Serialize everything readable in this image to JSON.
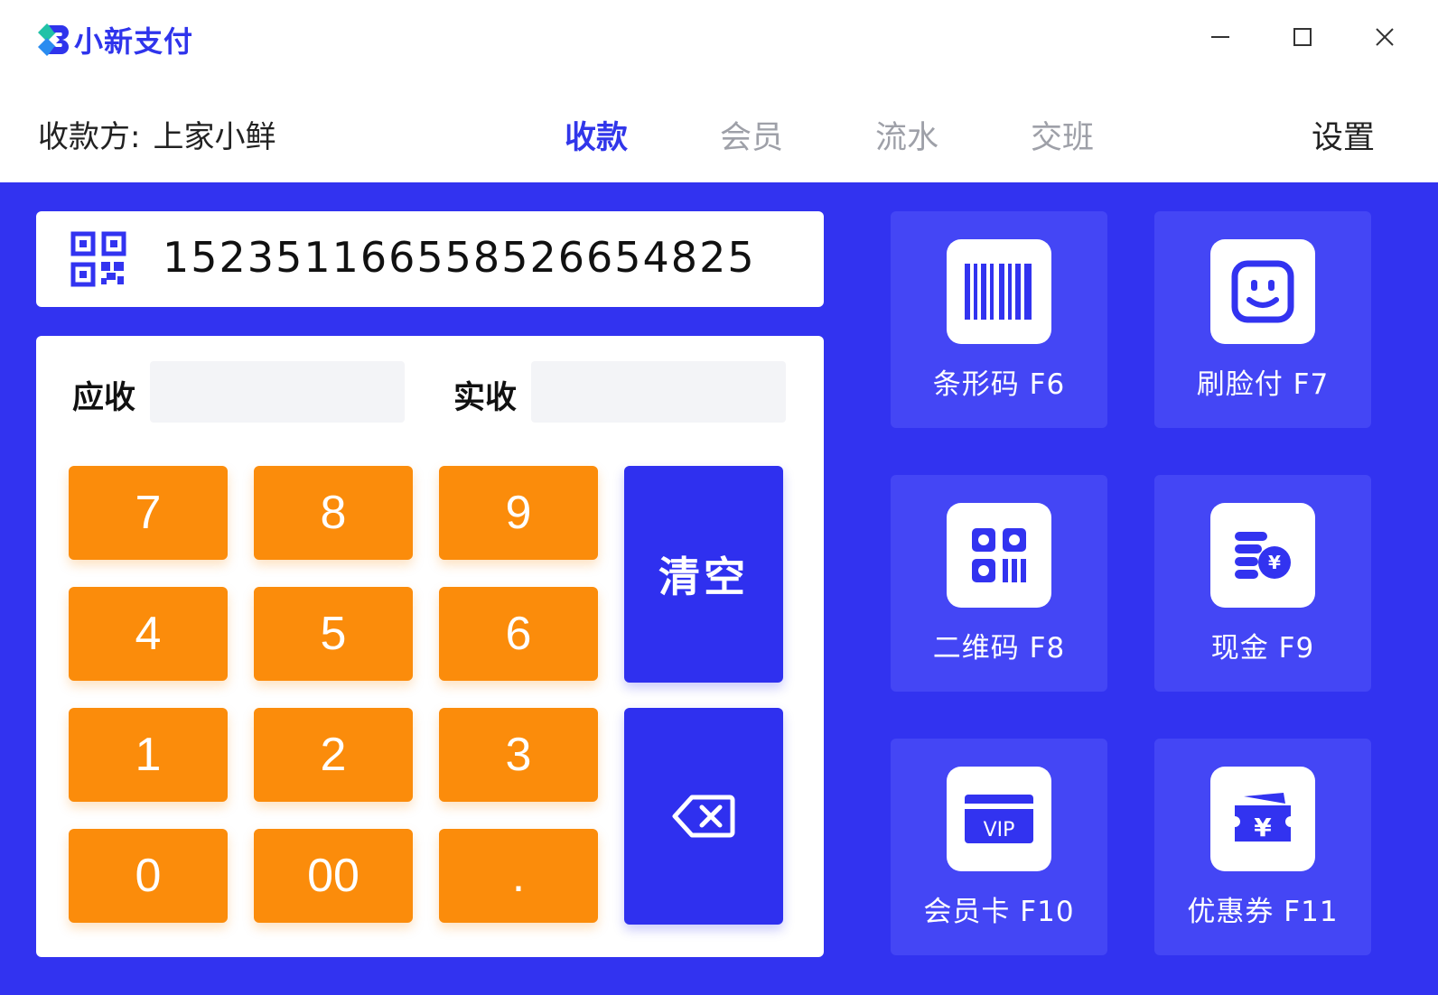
{
  "app": {
    "name": "小新支付"
  },
  "window_controls": {
    "minimize_icon": "minimize-icon",
    "maximize_icon": "maximize-icon",
    "close_icon": "close-icon"
  },
  "header": {
    "payee_label": "收款方:",
    "payee_value": "上家小鲜",
    "tabs": [
      {
        "label": "收款",
        "active": true
      },
      {
        "label": "会员",
        "active": false
      },
      {
        "label": "流水",
        "active": false
      },
      {
        "label": "交班",
        "active": false
      }
    ],
    "settings_label": "设置"
  },
  "scan": {
    "icon": "qr-code-icon",
    "code": "152351166558526654825"
  },
  "amounts": {
    "due_label": "应收",
    "due_value": "",
    "paid_label": "实收",
    "paid_value": ""
  },
  "keypad": {
    "keys": [
      "7",
      "8",
      "9",
      "4",
      "5",
      "6",
      "1",
      "2",
      "3",
      "0",
      "00",
      "."
    ],
    "clear_label": "清空",
    "backspace_icon": "backspace-icon"
  },
  "payment_methods": [
    {
      "label": "条形码 F6",
      "icon": "barcode-icon"
    },
    {
      "label": "刷脸付 F7",
      "icon": "face-icon"
    },
    {
      "label": "二维码 F8",
      "icon": "qr-code-icon"
    },
    {
      "label": "现金 F9",
      "icon": "cash-icon"
    },
    {
      "label": "会员卡 F10",
      "icon": "vip-card-icon",
      "icon_text": "VIP"
    },
    {
      "label": "优惠券 F11",
      "icon": "coupon-icon",
      "icon_text": "¥"
    }
  ],
  "colors": {
    "primary": "#3233f0",
    "tile": "#4446f5",
    "key": "#fb8c0b",
    "tab_inactive": "#9ea0a8"
  }
}
